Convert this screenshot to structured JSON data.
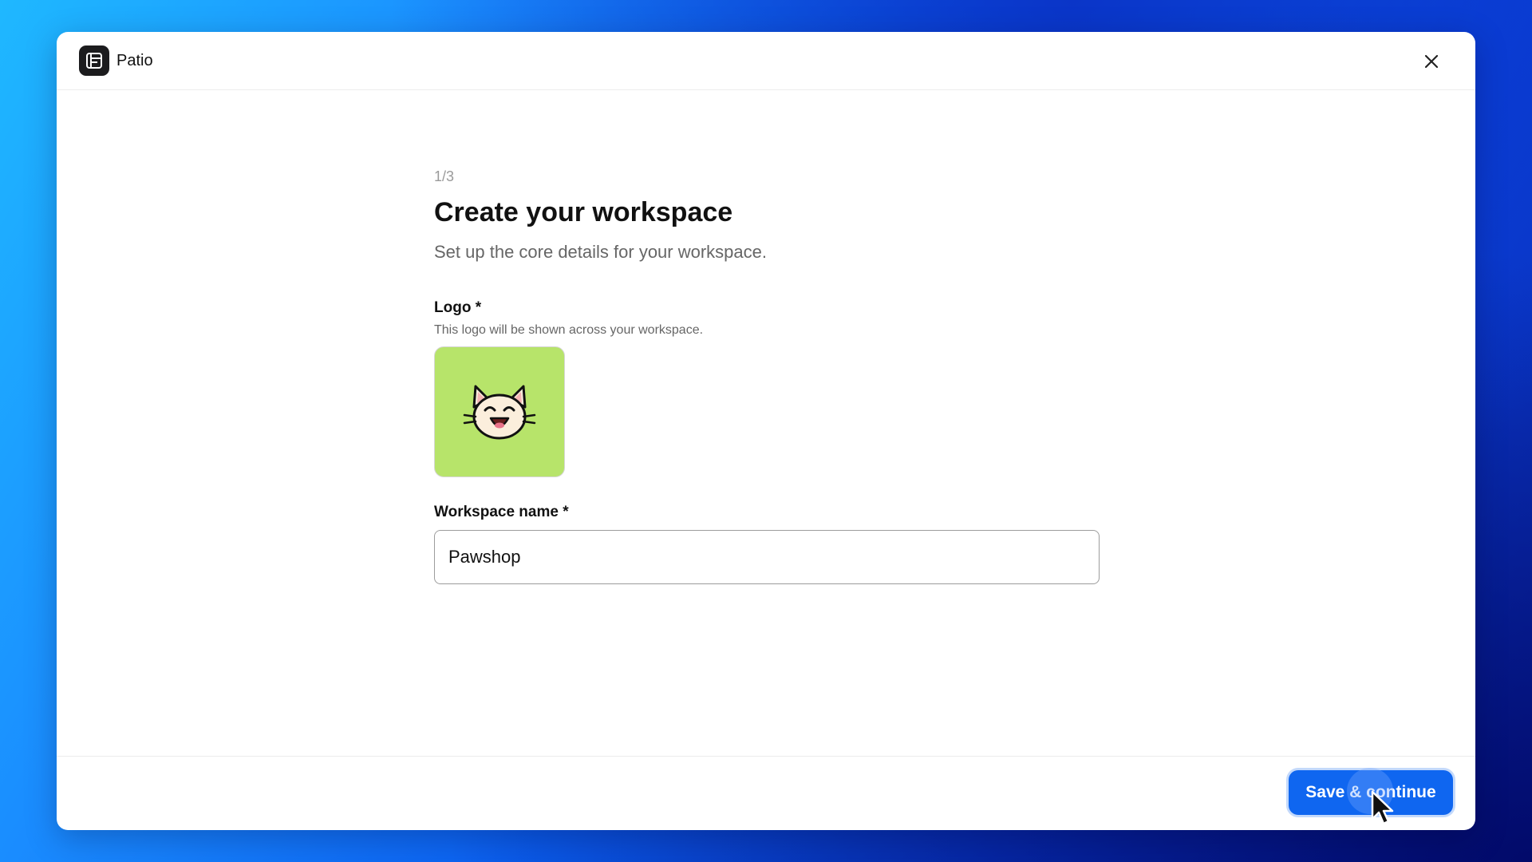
{
  "app": {
    "name": "Patio"
  },
  "wizard": {
    "step": "1/3",
    "title": "Create your workspace",
    "subtitle": "Set up the core details for your workspace."
  },
  "logo_field": {
    "label": "Logo *",
    "hint": "This logo will be shown across your workspace.",
    "emoji": "😺",
    "tile_color": "#b7e46a"
  },
  "name_field": {
    "label": "Workspace name *",
    "value": "Pawshop"
  },
  "footer": {
    "primary_label": "Save & continue"
  },
  "colors": {
    "accent": "#0f66f0"
  },
  "icons": {
    "app_logo": "patio-logo-icon",
    "close": "close-icon",
    "cursor": "mouse-pointer-icon"
  }
}
